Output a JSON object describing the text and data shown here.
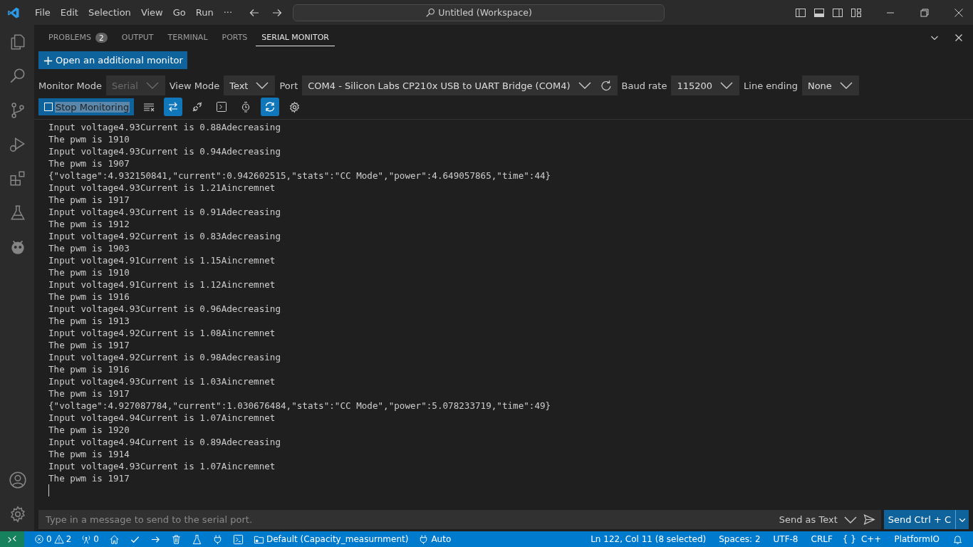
{
  "menu": [
    "File",
    "Edit",
    "Selection",
    "View",
    "Go",
    "Run",
    "···"
  ],
  "command_center": {
    "text": "Untitled (Workspace)"
  },
  "activity_bar": [
    {
      "kind": "explorer",
      "selected": false
    },
    {
      "kind": "search",
      "selected": false
    },
    {
      "kind": "source-control",
      "selected": false
    },
    {
      "kind": "run-debug",
      "selected": false
    },
    {
      "kind": "extensions",
      "selected": false
    },
    {
      "kind": "testing",
      "selected": false
    },
    {
      "kind": "platformio",
      "selected": false
    }
  ],
  "panel_tabs": [
    {
      "label": "PROBLEMS",
      "badge": "2",
      "selected": false
    },
    {
      "label": "OUTPUT",
      "selected": false
    },
    {
      "label": "TERMINAL",
      "selected": false
    },
    {
      "label": "PORTS",
      "selected": false
    },
    {
      "label": "SERIAL MONITOR",
      "selected": true
    }
  ],
  "open_monitor_button": {
    "icon": "+",
    "label": "Open an additional monitor"
  },
  "settings": [
    {
      "label": "Monitor Mode",
      "value": "Serial",
      "disabled": true
    },
    {
      "label": "View Mode",
      "value": "Text",
      "disabled": false
    },
    {
      "label": "Port",
      "value": "COM4 - Silicon Labs CP210x USB to UART Bridge (COM4)",
      "disabled": false,
      "refresh": true
    },
    {
      "label": "Baud rate",
      "value": "115200",
      "disabled": false
    },
    {
      "label": "Line ending",
      "value": "None",
      "disabled": false
    }
  ],
  "stop_button": {
    "label": "Stop Monitoring",
    "text_selected": true
  },
  "toolbar": [
    {
      "kind": "clear",
      "selected": false
    },
    {
      "kind": "autoscroll",
      "selected": true
    },
    {
      "kind": "connect",
      "selected": false
    },
    {
      "kind": "terminal",
      "selected": false
    },
    {
      "kind": "timestamp",
      "selected": false
    },
    {
      "kind": "sync",
      "selected": true
    },
    {
      "kind": "settings",
      "selected": false
    }
  ],
  "output_lines": [
    "Input voltage4.93Current is 0.88Adecreasing",
    "The pwm is 1910",
    "Input voltage4.93Current is 0.94Adecreasing",
    "The pwm is 1907",
    "{\"voltage\":4.932150841,\"current\":0.942602515,\"stats\":\"CC Mode\",\"power\":4.649057865,\"time\":44}",
    "Input voltage4.93Current is 1.21Aincremnet",
    "The pwm is 1917",
    "Input voltage4.93Current is 0.91Adecreasing",
    "The pwm is 1912",
    "Input voltage4.92Current is 0.83Adecreasing",
    "The pwm is 1903",
    "Input voltage4.91Current is 1.15Aincremnet",
    "The pwm is 1910",
    "Input voltage4.91Current is 1.12Aincremnet",
    "The pwm is 1916",
    "Input voltage4.93Current is 0.96Adecreasing",
    "The pwm is 1913",
    "Input voltage4.92Current is 1.08Aincremnet",
    "The pwm is 1917",
    "Input voltage4.92Current is 0.98Adecreasing",
    "The pwm is 1916",
    "Input voltage4.93Current is 1.03Aincremnet",
    "The pwm is 1917",
    "{\"voltage\":4.927087784,\"current\":1.030676484,\"stats\":\"CC Mode\",\"power\":5.078233719,\"time\":49}",
    "Input voltage4.94Current is 1.07Aincremnet",
    "The pwm is 1920",
    "Input voltage4.94Current is 0.89Adecreasing",
    "The pwm is 1914",
    "Input voltage4.93Current is 1.07Aincremnet",
    "The pwm is 1917"
  ],
  "message_input": {
    "placeholder": "Type in a message to send to the serial port."
  },
  "send_mode": {
    "label": "Send as Text"
  },
  "send_ctrl_c": {
    "label": "Send Ctrl + C"
  },
  "status_left": [
    {
      "kind": "problems",
      "errors": "0",
      "warnings": "2"
    },
    {
      "kind": "ports",
      "text": "0"
    },
    {
      "kind": "home"
    },
    {
      "kind": "build"
    },
    {
      "kind": "upload"
    },
    {
      "kind": "clean"
    },
    {
      "kind": "test"
    },
    {
      "kind": "serial"
    },
    {
      "kind": "terminal"
    },
    {
      "kind": "env",
      "text": "Default (Capacity_measurnment)"
    },
    {
      "kind": "port",
      "text": "Auto"
    }
  ],
  "status_right": [
    {
      "text": "Ln 122, Col 11 (8 selected)"
    },
    {
      "text": "Spaces: 2"
    },
    {
      "text": "UTF-8"
    },
    {
      "text": "CRLF"
    },
    {
      "text": "C++",
      "prefix": "{ }"
    },
    {
      "text": "PlatformIO"
    }
  ]
}
